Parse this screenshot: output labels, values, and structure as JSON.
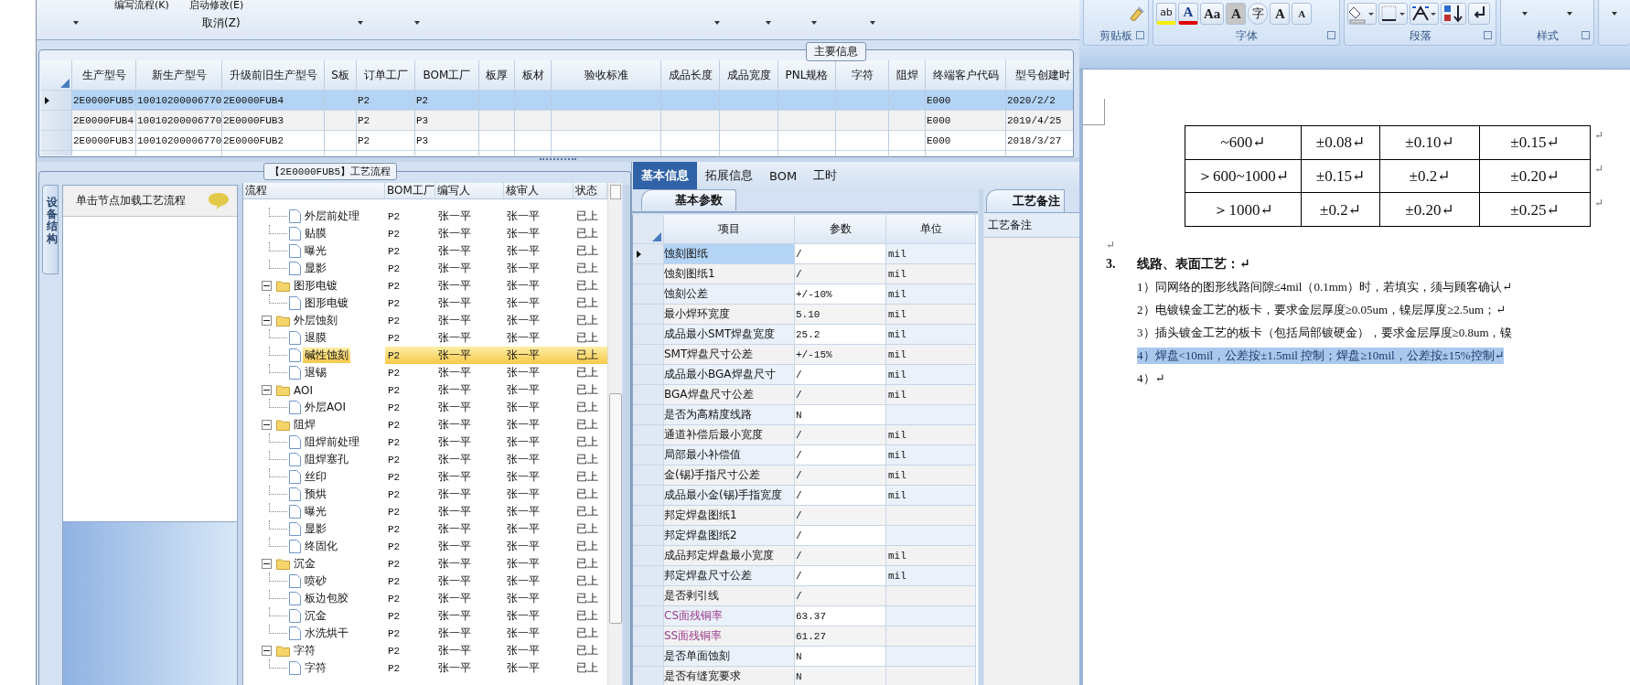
{
  "toolbar": {
    "top_labels": [
      "编写流程(K)",
      "启动修改(E)"
    ],
    "cancel": "取消(Z)"
  },
  "main_info": {
    "title": "主要信息",
    "columns": [
      "生产型号",
      "新生产型号",
      "升级前旧生产型号",
      "S板",
      "订单工厂",
      "BOM工厂",
      "板厚",
      "板材",
      "验收标准",
      "成品长度",
      "成品宽度",
      "PNL规格",
      "字符",
      "阻焊",
      "终端客户代码",
      "型号创建时"
    ],
    "rows": [
      {
        "selected": true,
        "production_model": "2E0000FUB5",
        "new_model": "10010200006770",
        "old_model": "2E0000FUB4",
        "order_factory": "P2",
        "bom_factory": "P2",
        "customer_code": "E000",
        "created_at": "2020/2/2"
      },
      {
        "selected": false,
        "production_model": "2E0000FUB4",
        "new_model": "10010200006770",
        "old_model": "2E0000FUB3",
        "order_factory": "P2",
        "bom_factory": "P3",
        "customer_code": "E000",
        "created_at": "2019/4/25"
      },
      {
        "selected": false,
        "production_model": "2E0000FUB3",
        "new_model": "10010200006770",
        "old_model": "2E0000FUB2",
        "order_factory": "P2",
        "bom_factory": "P3",
        "customer_code": "E000",
        "created_at": "2018/3/27"
      }
    ]
  },
  "flow": {
    "title": "【2E0000FUB5】工艺流程",
    "side_tab": "设备结构",
    "side_hint": "单击节点加载工艺流程",
    "columns": [
      "流程",
      "BOM工厂",
      "编写人",
      "核审人",
      "状态"
    ],
    "tree": [
      {
        "children": [
          {
            "name": "外层前处理",
            "bom": "P2",
            "writer": "张一平",
            "reviewer": "张一平",
            "status": "已上",
            "selected": false
          },
          {
            "name": "贴膜",
            "bom": "P2",
            "writer": "张一平",
            "reviewer": "张一平",
            "status": "已上",
            "selected": false
          },
          {
            "name": "曝光",
            "bom": "P2",
            "writer": "张一平",
            "reviewer": "张一平",
            "status": "已上",
            "selected": false
          },
          {
            "name": "显影",
            "bom": "P2",
            "writer": "张一平",
            "reviewer": "张一平",
            "status": "已上",
            "selected": false
          }
        ]
      },
      {
        "name": "图形电镀",
        "bom": "P2",
        "writer": "张一平",
        "reviewer": "张一平",
        "status": "已上",
        "selected": false,
        "expanded": true,
        "children": [
          {
            "name": "图形电镀",
            "bom": "P2",
            "writer": "张一平",
            "reviewer": "张一平",
            "status": "已上",
            "selected": false
          }
        ]
      },
      {
        "name": "外层蚀刻",
        "bom": "P2",
        "writer": "张一平",
        "reviewer": "张一平",
        "status": "已上",
        "selected": false,
        "expanded": true,
        "children": [
          {
            "name": "退膜",
            "bom": "P2",
            "writer": "张一平",
            "reviewer": "张一平",
            "status": "已上",
            "selected": false
          },
          {
            "name": "碱性蚀刻",
            "bom": "P2",
            "writer": "张一平",
            "reviewer": "张一平",
            "status": "已上",
            "selected": true
          },
          {
            "name": "退锡",
            "bom": "P2",
            "writer": "张一平",
            "reviewer": "张一平",
            "status": "已上",
            "selected": false
          }
        ]
      },
      {
        "name": "AOI",
        "bom": "P2",
        "writer": "张一平",
        "reviewer": "张一平",
        "status": "已上",
        "selected": false,
        "expanded": true,
        "children": [
          {
            "name": "外层AOI",
            "bom": "P2",
            "writer": "张一平",
            "reviewer": "张一平",
            "status": "已上",
            "selected": false
          }
        ]
      },
      {
        "name": "阻焊",
        "bom": "P2",
        "writer": "张一平",
        "reviewer": "张一平",
        "status": "已上",
        "selected": false,
        "expanded": true,
        "children": [
          {
            "name": "阻焊前处理",
            "bom": "P2",
            "writer": "张一平",
            "reviewer": "张一平",
            "status": "已上",
            "selected": false
          },
          {
            "name": "阻焊塞孔",
            "bom": "P2",
            "writer": "张一平",
            "reviewer": "张一平",
            "status": "已上",
            "selected": false
          },
          {
            "name": "丝印",
            "bom": "P2",
            "writer": "张一平",
            "reviewer": "张一平",
            "status": "已上",
            "selected": false
          },
          {
            "name": "预烘",
            "bom": "P2",
            "writer": "张一平",
            "reviewer": "张一平",
            "status": "已上",
            "selected": false
          },
          {
            "name": "曝光",
            "bom": "P2",
            "writer": "张一平",
            "reviewer": "张一平",
            "status": "已上",
            "selected": false
          },
          {
            "name": "显影",
            "bom": "P2",
            "writer": "张一平",
            "reviewer": "张一平",
            "status": "已上",
            "selected": false
          },
          {
            "name": "终固化",
            "bom": "P2",
            "writer": "张一平",
            "reviewer": "张一平",
            "status": "已上",
            "selected": false
          }
        ]
      },
      {
        "name": "沉金",
        "bom": "P2",
        "writer": "张一平",
        "reviewer": "张一平",
        "status": "已上",
        "selected": false,
        "expanded": true,
        "children": [
          {
            "name": "喷砂",
            "bom": "P2",
            "writer": "张一平",
            "reviewer": "张一平",
            "status": "已上",
            "selected": false
          },
          {
            "name": "板边包胶",
            "bom": "P2",
            "writer": "张一平",
            "reviewer": "张一平",
            "status": "已上",
            "selected": false
          },
          {
            "name": "沉金",
            "bom": "P2",
            "writer": "张一平",
            "reviewer": "张一平",
            "status": "已上",
            "selected": false
          },
          {
            "name": "水洗烘干",
            "bom": "P2",
            "writer": "张一平",
            "reviewer": "张一平",
            "status": "已上",
            "selected": false
          }
        ]
      },
      {
        "name": "字符",
        "bom": "P2",
        "writer": "张一平",
        "reviewer": "张一平",
        "status": "已上",
        "selected": false,
        "expanded": true,
        "children": [
          {
            "name": "字符",
            "bom": "P2",
            "writer": "张一平",
            "reviewer": "张一平",
            "status": "已上",
            "selected": false
          }
        ]
      }
    ]
  },
  "detail": {
    "tabs": [
      {
        "label": "基本信息",
        "selected": true
      },
      {
        "label": "拓展信息",
        "selected": false
      },
      {
        "label": "BOM",
        "selected": false
      },
      {
        "label": "工时",
        "selected": false
      }
    ],
    "params_title": "基本参数",
    "columns": [
      "项目",
      "参数",
      "单位"
    ],
    "rows": [
      {
        "item": "蚀刻图纸",
        "value": "/",
        "unit": "mil",
        "selected": true
      },
      {
        "item": "蚀刻图纸1",
        "value": "/",
        "unit": "mil",
        "selected": false
      },
      {
        "item": "蚀刻公差",
        "value": "+/-10%",
        "unit": "mil",
        "selected": false
      },
      {
        "item": "最小焊环宽度",
        "value": "5.10",
        "unit": "mil",
        "selected": false
      },
      {
        "item": "成品最小SMT焊盘宽度",
        "value": "25.2",
        "unit": "mil",
        "selected": false
      },
      {
        "item": "SMT焊盘尺寸公差",
        "value": "+/-15%",
        "unit": "mil",
        "selected": false
      },
      {
        "item": "成品最小BGA焊盘尺寸",
        "value": "/",
        "unit": "mil",
        "selected": false
      },
      {
        "item": "BGA焊盘尺寸公差",
        "value": "/",
        "unit": "mil",
        "selected": false
      },
      {
        "item": "是否为高精度线路",
        "value": "N",
        "selected": false
      },
      {
        "item": "通道补偿后最小宽度",
        "value": "/",
        "unit": "mil",
        "selected": false
      },
      {
        "item": "局部最小补偿值",
        "value": "/",
        "unit": "mil",
        "selected": false
      },
      {
        "item": "金(锡)手指尺寸公差",
        "value": "/",
        "unit": "mil",
        "selected": false
      },
      {
        "item": "成品最小金(锡)手指宽度",
        "value": "/",
        "unit": "mil",
        "selected": false
      },
      {
        "item": "邦定焊盘图纸1",
        "value": "/",
        "selected": false
      },
      {
        "item": "邦定焊盘图纸2",
        "value": "/",
        "selected": false
      },
      {
        "item": "成品邦定焊盘最小宽度",
        "value": "/",
        "unit": "mil",
        "selected": false
      },
      {
        "item": "邦定焊盘尺寸公差",
        "value": "/",
        "unit": "mil",
        "selected": false
      },
      {
        "item": "是否剥引线",
        "value": "/",
        "selected": false
      },
      {
        "item": "CS面残铜率",
        "value": "63.37",
        "selected": false,
        "color": "#9a3c8c"
      },
      {
        "item": "SS面残铜率",
        "value": "61.27",
        "selected": false,
        "color": "#9a3c8c"
      },
      {
        "item": "是否单面蚀刻",
        "value": "N",
        "selected": false
      },
      {
        "item": "是否有缝宽要求",
        "value": "N",
        "selected": false
      }
    ],
    "notes_title": "工艺备注",
    "notes_label": "工艺备注"
  },
  "word": {
    "ribbon": {
      "groups": [
        "剪贴板",
        "字体",
        "段落",
        "样式"
      ],
      "font_buttons": [
        {
          "label": "ab",
          "kind": "highlight"
        },
        {
          "label": "A",
          "kind": "color"
        },
        {
          "label": "Aa",
          "kind": "plain"
        },
        {
          "label": "A",
          "kind": "shaded"
        },
        {
          "label": "字",
          "kind": "circled"
        },
        {
          "label": "A",
          "kind": "grow"
        },
        {
          "label": "A",
          "kind": "shrink"
        }
      ]
    },
    "table": [
      {
        "cells": [
          "~600↵",
          "±0.08↵",
          "±0.10↵",
          "±0.15↵"
        ],
        "mark": "↵"
      },
      {
        "cells": [
          "＞600~1000↵",
          "±0.15↵",
          "±0.2↵",
          "±0.20↵"
        ],
        "mark": "↵"
      },
      {
        "cells": [
          "＞1000↵",
          "±0.2↵",
          "±0.20↵",
          "±0.25↵"
        ],
        "mark": "↵"
      }
    ],
    "blank_mark": "↵",
    "heading": {
      "number": "3.",
      "title": "线路、表面工艺：↵"
    },
    "items": [
      {
        "text": "1）同网络的图形线路间隙≤4mil（0.1mm）时，若填实，须与顾客确认↵",
        "selected": false
      },
      {
        "text": "2）电镀镍金工艺的板卡，要求金层厚度≥0.05um，镍层厚度≥2.5um；↵",
        "selected": false
      },
      {
        "text": "3）插头镀金工艺的板卡（包括局部镀硬金），要求金层厚度≥0.8um，镍",
        "selected": false
      },
      {
        "text": "4）焊盘<10mil，公差按±1.5mil 控制；焊盘≥10mil，公差按±15%控制↵",
        "selected": true
      },
      {
        "text": "4）↵",
        "selected": false
      }
    ]
  }
}
